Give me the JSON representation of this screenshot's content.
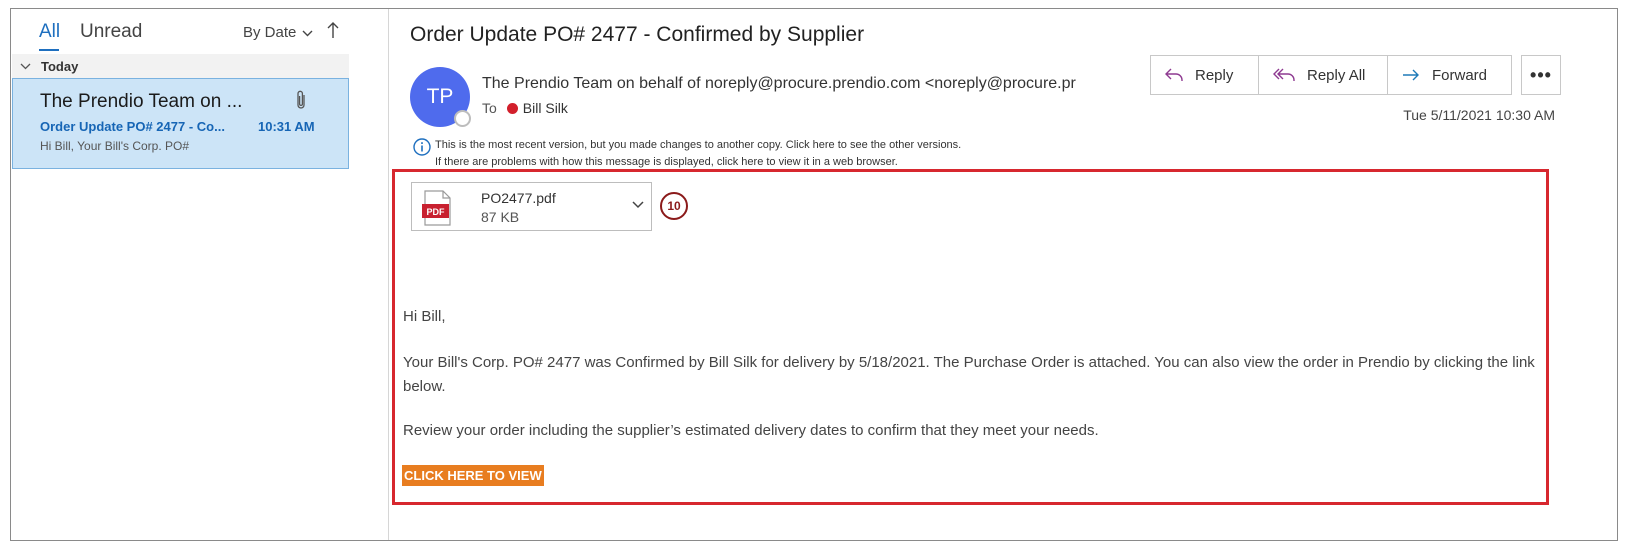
{
  "list": {
    "filters": {
      "all": "All",
      "unread": "Unread"
    },
    "sort_label": "By Date",
    "sort_direction_icon": "arrow-up-icon",
    "group_label": "Today",
    "message": {
      "sender": "The Prendio Team on ...",
      "subject": "Order Update PO# 2477 - Co...",
      "time": "10:31 AM",
      "preview": "Hi Bill,  Your Bill's Corp. PO#",
      "has_attachment": true
    }
  },
  "email": {
    "subject": "Order Update PO# 2477 - Confirmed by Supplier",
    "avatar_initials": "TP",
    "from": "The Prendio Team on behalf of noreply@procure.prendio.com <noreply@procure.pr",
    "to_label": "To",
    "to_name": "Bill Silk",
    "date": "Tue 5/11/2021 10:30 AM",
    "actions": {
      "reply": "Reply",
      "reply_all": "Reply All",
      "forward": "Forward",
      "more": "•••"
    },
    "info_line_1": "This is the most recent version, but you made changes to another copy. Click here to see the other versions.",
    "info_line_2": "If there are problems with how this message is displayed, click here to view it in a web browser.",
    "attachment": {
      "name": "PO2477.pdf",
      "size": "87 KB",
      "type_label": "PDF"
    },
    "step_badge": "10",
    "body": {
      "greeting": "Hi Bill,",
      "paragraph_1": "Your Bill's Corp. PO# 2477 was Confirmed by Bill Silk for delivery by 5/18/2021. The Purchase Order is attached. You can also view the order in Prendio by clicking the link below.",
      "paragraph_2": "Review your order including the supplier’s estimated delivery dates to confirm that they meet your needs.",
      "cta": "CLICK HERE TO VIEW"
    }
  },
  "colors": {
    "accent": "#1e6fbf",
    "selected_bg": "#cce4f7",
    "avatar": "#4f6bed",
    "highlight": "#d7282f",
    "cta": "#e87d20",
    "presence_busy": "#d21f2b"
  }
}
